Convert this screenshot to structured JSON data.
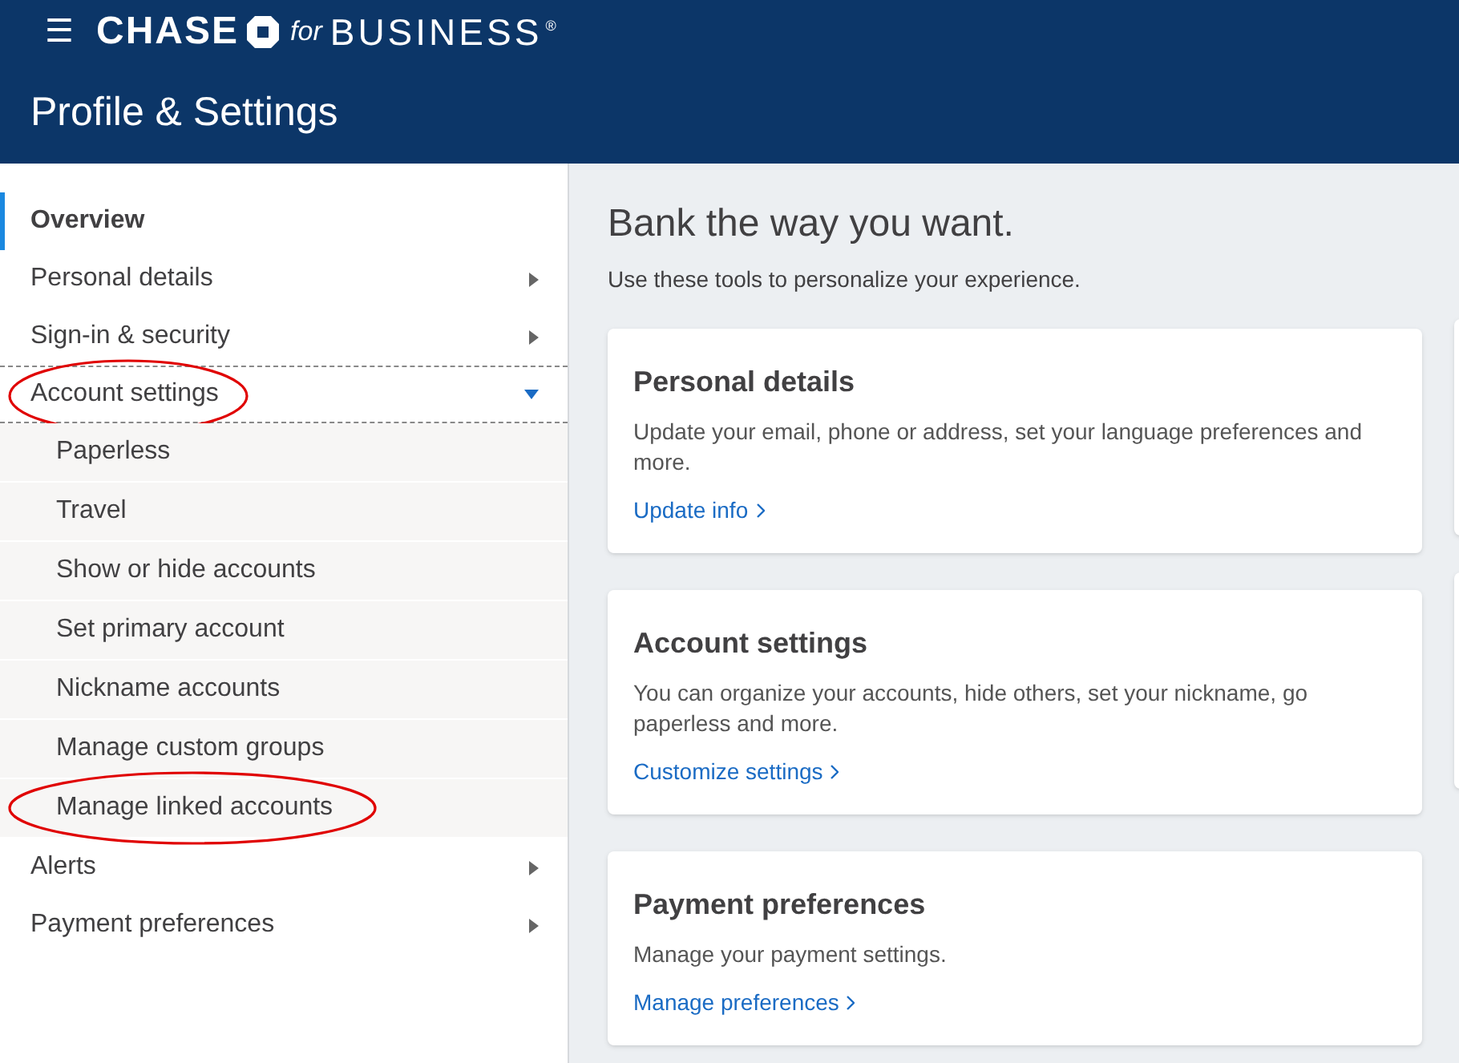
{
  "header": {
    "menu_icon": "☰",
    "logo": {
      "brand": "CHASE",
      "connector": "for",
      "product": "BUSINESS",
      "registered": "®"
    },
    "title": "Profile & Settings"
  },
  "sidebar": {
    "items": [
      {
        "label": "Overview",
        "selected": true,
        "expanded": false,
        "has_arrow": false,
        "circled": false
      },
      {
        "label": "Personal details",
        "selected": false,
        "expanded": false,
        "has_arrow": true,
        "circled": false
      },
      {
        "label": "Sign-in & security",
        "selected": false,
        "expanded": false,
        "has_arrow": true,
        "circled": false
      },
      {
        "label": "Account settings",
        "selected": false,
        "expanded": true,
        "has_arrow": true,
        "circled": true,
        "children": [
          {
            "label": "Paperless",
            "circled": false
          },
          {
            "label": "Travel",
            "circled": false
          },
          {
            "label": "Show or hide accounts",
            "circled": false
          },
          {
            "label": "Set primary account",
            "circled": false
          },
          {
            "label": "Nickname accounts",
            "circled": false
          },
          {
            "label": "Manage custom groups",
            "circled": false
          },
          {
            "label": "Manage linked accounts",
            "circled": true
          }
        ]
      },
      {
        "label": "Alerts",
        "selected": false,
        "expanded": false,
        "has_arrow": true,
        "circled": false
      },
      {
        "label": "Payment preferences",
        "selected": false,
        "expanded": false,
        "has_arrow": true,
        "circled": false
      }
    ]
  },
  "main": {
    "heading": "Bank the way you want.",
    "subheading": "Use these tools to personalize your experience.",
    "cards": [
      {
        "title": "Personal details",
        "description": "Update your email, phone or address, set your language preferences and more.",
        "link": "Update info"
      },
      {
        "title": "Account settings",
        "description": "You can organize your accounts, hide others, set your nickname, go paperless and more.",
        "link": "Customize settings"
      },
      {
        "title": "Payment preferences",
        "description": "Manage your payment settings.",
        "link": "Manage preferences"
      }
    ]
  }
}
